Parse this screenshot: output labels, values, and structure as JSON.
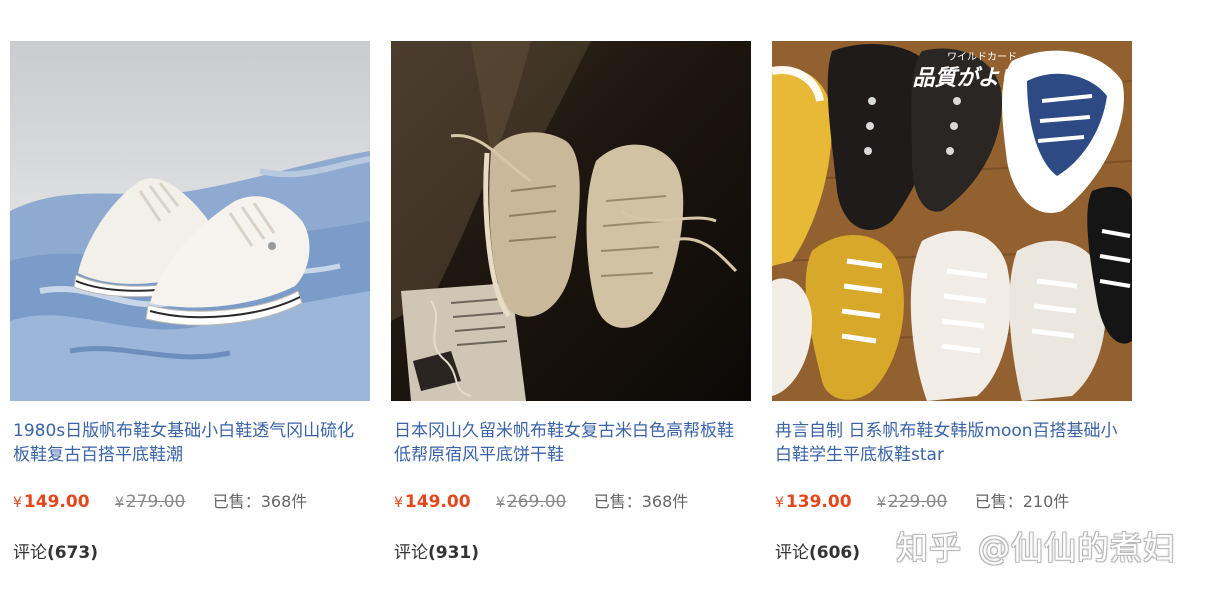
{
  "products": [
    {
      "title": "1980s日版帆布鞋女基础小白鞋透气冈山硫化板鞋复古百搭平底鞋潮",
      "currency": "¥",
      "price": "149.00",
      "original_price": "279.00",
      "sold": "已售：368件",
      "comments_label": "评论",
      "comments_count": "(673)"
    },
    {
      "title": "日本冈山久留米帆布鞋女复古米白色高帮板鞋低帮原宿风平底饼干鞋",
      "currency": "¥",
      "price": "149.00",
      "original_price": "269.00",
      "sold": "已售：368件",
      "comments_label": "评论",
      "comments_count": "(931)"
    },
    {
      "title": "冉言自制 日系帆布鞋女韩版moon百搭基础小白鞋学生平底板鞋star",
      "currency": "¥",
      "price": "139.00",
      "original_price": "229.00",
      "sold": "已售：210件",
      "comments_label": "评论",
      "comments_count": "(606)",
      "image_text_small": "ワイルドカード",
      "image_text_large": "品質がよい"
    }
  ],
  "watermark": {
    "brand": "知乎",
    "author": "@仙仙的煮妇"
  },
  "colors": {
    "title_link": "#3a63a8",
    "price": "#e4471c",
    "original_price": "#8a8a8a"
  }
}
